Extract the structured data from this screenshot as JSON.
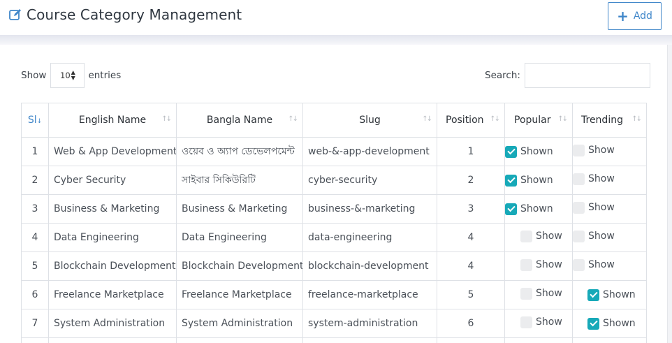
{
  "header": {
    "title": "Course Category Management",
    "add_label": "Add"
  },
  "controls": {
    "show_label": "Show",
    "page_length": "10",
    "entries_label": "entries",
    "search_label": "Search:",
    "search_value": ""
  },
  "table": {
    "columns": [
      "Sl",
      "English Name",
      "Bangla Name",
      "Slug",
      "Position",
      "Popular",
      "Trending"
    ],
    "rows": [
      {
        "sl": "1",
        "english": "Web & App Development",
        "bangla": "ওয়েব ও অ্যাপ ডেভেলপমেন্ট",
        "slug": "web-&-app-development",
        "position": "1",
        "popular": "Shown",
        "popular_on": true,
        "trending": "Show",
        "trending_on": false
      },
      {
        "sl": "2",
        "english": "Cyber Security",
        "bangla": "সাইবার সিকিউরিটি",
        "slug": "cyber-security",
        "position": "2",
        "popular": "Shown",
        "popular_on": true,
        "trending": "Show",
        "trending_on": false
      },
      {
        "sl": "3",
        "english": "Business & Marketing",
        "bangla": "Business & Marketing",
        "slug": "business-&-marketing",
        "position": "3",
        "popular": "Shown",
        "popular_on": true,
        "trending": "Show",
        "trending_on": false
      },
      {
        "sl": "4",
        "english": "Data Engineering",
        "bangla": "Data Engineering",
        "slug": "data-engineering",
        "position": "4",
        "popular": "Show",
        "popular_on": false,
        "trending": "Show",
        "trending_on": false
      },
      {
        "sl": "5",
        "english": "Blockchain Development",
        "bangla": "Blockchain Development",
        "slug": "blockchain-development",
        "position": "4",
        "popular": "Show",
        "popular_on": false,
        "trending": "Show",
        "trending_on": false
      },
      {
        "sl": "6",
        "english": "Freelance Marketplace",
        "bangla": "Freelance Marketplace",
        "slug": "freelance-marketplace",
        "position": "5",
        "popular": "Show",
        "popular_on": false,
        "trending": "Shown",
        "trending_on": true
      },
      {
        "sl": "7",
        "english": "System Administration",
        "bangla": "System Administration",
        "slug": "system-administration",
        "position": "6",
        "popular": "Show",
        "popular_on": false,
        "trending": "Shown",
        "trending_on": true
      }
    ]
  },
  "colors": {
    "accent": "#3f86c9",
    "checkbox_on": "#17a9b8",
    "checkbox_off": "#ebecee"
  },
  "icons": {
    "title": "edit-icon",
    "add": "plus-icon",
    "sort": "sort-icon",
    "length": "updown-arrows-icon"
  }
}
